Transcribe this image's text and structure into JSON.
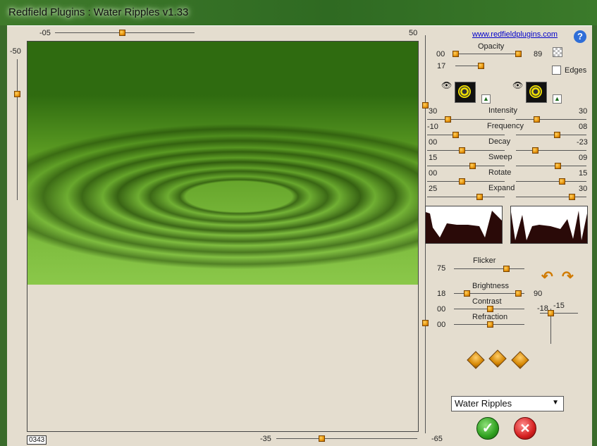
{
  "window": {
    "title": "Redfield Plugins : Water Ripples v1.33"
  },
  "header": {
    "link": "www.redfieldplugins.com",
    "help": "?"
  },
  "top_slider": {
    "left_label": "-05",
    "right_label": "50"
  },
  "left_slider": {
    "label": "-50"
  },
  "bottom_slider": {
    "label": "-35",
    "right_label": "-65"
  },
  "counter": "0343",
  "opacity": {
    "label": "Opacity",
    "min": "00",
    "max": "89",
    "second_value": "17"
  },
  "edges": {
    "label": "Edges"
  },
  "params": [
    {
      "label": "Intensity",
      "left": "30",
      "right": "30"
    },
    {
      "label": "Frequency",
      "left": "-10",
      "right": "08"
    },
    {
      "label": "Decay",
      "left": "00",
      "right": "-23"
    },
    {
      "label": "Sweep",
      "left": "15",
      "right": "09"
    },
    {
      "label": "Rotate",
      "left": "00",
      "right": "15"
    },
    {
      "label": "Expand",
      "left": "25",
      "right": "30"
    }
  ],
  "lower": {
    "flicker": {
      "label": "Flicker",
      "value": "75"
    },
    "brightness": {
      "label": "Brightness",
      "left": "18",
      "right": "90"
    },
    "contrast": {
      "label": "Contrast",
      "value": "00"
    },
    "refraction": {
      "label": "Refraction",
      "value": "00"
    },
    "xy": {
      "x": "-18",
      "y": "-15"
    }
  },
  "preset": {
    "selected": "Water Ripples"
  },
  "buttons": {
    "ok": "✓",
    "cancel": "✕"
  },
  "colors": {
    "title_bg": "#3f7a2b",
    "panel_bg": "#e4ddcf",
    "knob": "#e08a00"
  },
  "icons": [
    "eye-icon",
    "ripple-swatch-icon",
    "undo-arrow-icon",
    "redo-arrow-icon",
    "random-dice-icon"
  ]
}
